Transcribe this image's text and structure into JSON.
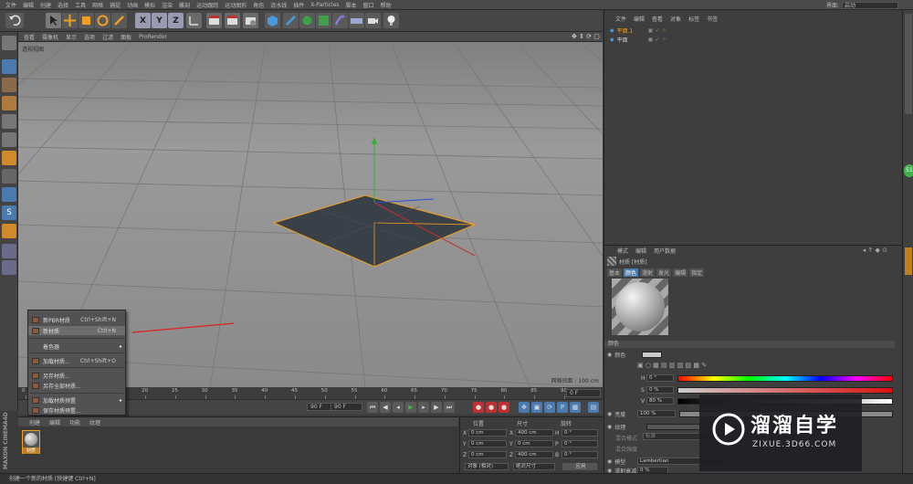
{
  "menubar": {
    "items": [
      "文件",
      "编辑",
      "创建",
      "选择",
      "工具",
      "网格",
      "捕捉",
      "动画",
      "模拟",
      "渲染",
      "雕刻",
      "运动跟踪",
      "运动图形",
      "角色",
      "流水线",
      "插件",
      "X-Particles",
      "脚本",
      "窗口",
      "帮助"
    ],
    "layout_label": "界面:",
    "layout_value": "启动"
  },
  "toolbar": {
    "axis_x": "X",
    "axis_y": "Y",
    "axis_z": "Z"
  },
  "viewport": {
    "menu": [
      "查看",
      "摄像机",
      "显示",
      "选项",
      "过滤",
      "面板",
      "ProRender"
    ],
    "persp_label": "透视视图",
    "grid_size": "网格间距 : 100 cm"
  },
  "timeline": {
    "ticks": [
      "0",
      "5",
      "10",
      "15",
      "20",
      "25",
      "30",
      "35",
      "40",
      "45",
      "50",
      "55",
      "60",
      "65",
      "70",
      "75",
      "80",
      "85",
      "90"
    ],
    "end_frame": "0 F",
    "field_frame": "90 F",
    "field_start": "90 F"
  },
  "context_menu": {
    "items": [
      {
        "label": "新PBR材质",
        "shortcut": "Ctrl+Shift+N"
      },
      {
        "label": "新材质",
        "shortcut": "Ctrl+N"
      },
      {
        "label": "着色器",
        "shortcut": ""
      },
      {
        "label": "加载材质...",
        "shortcut": "Ctrl+Shift+O"
      },
      {
        "label": "另存材质...",
        "shortcut": ""
      },
      {
        "label": "另存全部材质...",
        "shortcut": ""
      },
      {
        "label": "加载材质预置",
        "shortcut": ""
      },
      {
        "label": "保存材质预置...",
        "shortcut": ""
      }
    ]
  },
  "material_panel": {
    "tabs": [
      "创建",
      "编辑",
      "功能",
      "纹理"
    ],
    "material_name": "材质"
  },
  "coords": {
    "headers": [
      "位置",
      "尺寸",
      "旋转"
    ],
    "rows": [
      {
        "axis": "X",
        "pos": "0 cm",
        "size_axis": "X",
        "size": "400 cm",
        "rot_axis": "H",
        "rot": "0 °"
      },
      {
        "axis": "Y",
        "pos": "0 cm",
        "size_axis": "Y",
        "size": "0 cm",
        "rot_axis": "P",
        "rot": "0 °"
      },
      {
        "axis": "Z",
        "pos": "0 cm",
        "size_axis": "Z",
        "size": "400 cm",
        "rot_axis": "B",
        "rot": "0 °"
      }
    ],
    "mode": "对象 (相对)",
    "size_mode": "绝对尺寸",
    "apply": "应用"
  },
  "objects": {
    "tabs": [
      "文件",
      "编辑",
      "查看",
      "对象",
      "标签",
      "书签"
    ],
    "items": [
      "平面.1",
      "平面"
    ]
  },
  "attributes": {
    "tabs": [
      "模式",
      "编辑",
      "用户数据"
    ],
    "title": "材质 [材质]",
    "subtabs": [
      "基本",
      "颜色",
      "漫射",
      "发光",
      "编辑",
      "指定"
    ],
    "section": "颜色",
    "color_label": "颜色",
    "h_label": "H",
    "h_value": "0 °",
    "s_label": "S",
    "s_value": "0 %",
    "v_label": "V",
    "v_value": "80 %",
    "brightness_label": "亮度",
    "brightness_value": "100 %",
    "texture_label": "纹理",
    "mix_mode_label": "混合模式",
    "mix_mode_value": "标准",
    "mix_strength_label": "混合强度",
    "model_label": "模型",
    "model_value": "Lambertian",
    "diffuse_label": "漫射衰减",
    "diffuse_value": "0 %"
  },
  "statusbar": {
    "text": "创建一个新的材质 [快捷键 Ctrl+N]"
  },
  "watermark": {
    "cn": "溜溜自学",
    "en": "ZIXUE.3D66.COM"
  },
  "greendot": {
    "text": "51"
  },
  "colors": {
    "accent_orange": "#f0a020",
    "plane": "#3a4048",
    "axis_x": "#c03030",
    "axis_y": "#30b030",
    "axis_z": "#3050d0"
  }
}
